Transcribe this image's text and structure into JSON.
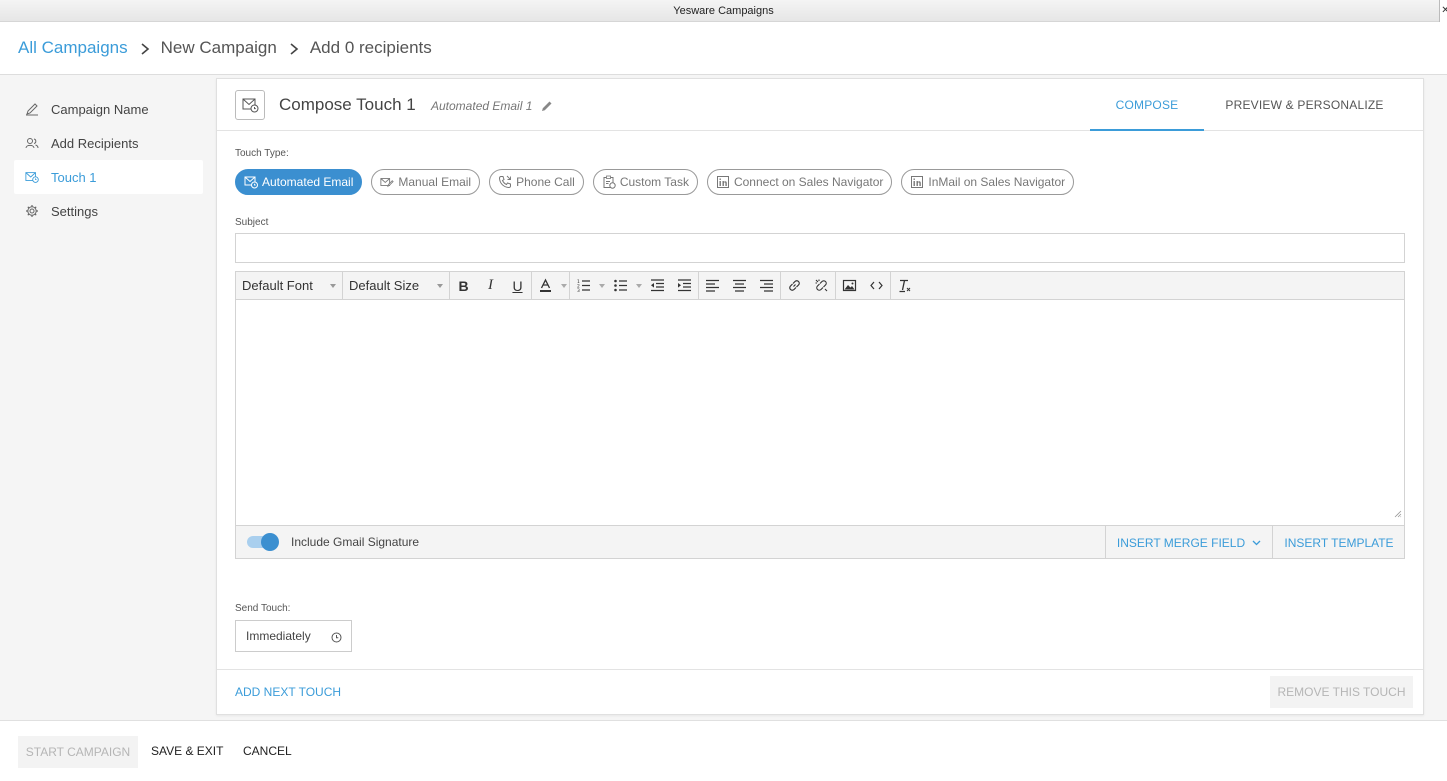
{
  "window": {
    "title": "Yesware Campaigns"
  },
  "breadcrumb": {
    "all_campaigns": "All Campaigns",
    "new_campaign": "New Campaign",
    "add_recipients": "Add 0 recipients"
  },
  "sidebar": {
    "items": [
      {
        "label": "Campaign Name",
        "icon": "pencil-icon"
      },
      {
        "label": "Add Recipients",
        "icon": "users-icon"
      },
      {
        "label": "Touch 1",
        "icon": "email-clock-icon",
        "active": true
      },
      {
        "label": "Settings",
        "icon": "gear-icon"
      }
    ]
  },
  "compose": {
    "title": "Compose Touch 1",
    "subtitle": "Automated Email 1",
    "tabs": {
      "compose": "COMPOSE",
      "preview": "PREVIEW & PERSONALIZE"
    },
    "touch_type_label": "Touch Type:",
    "touch_types": [
      {
        "label": "Automated Email",
        "active": true
      },
      {
        "label": "Manual Email"
      },
      {
        "label": "Phone Call"
      },
      {
        "label": "Custom Task"
      },
      {
        "label": "Connect on Sales Navigator"
      },
      {
        "label": "InMail on Sales Navigator"
      }
    ],
    "subject_label": "Subject",
    "subject_value": "",
    "editor": {
      "font": "Default Font",
      "size": "Default Size",
      "body": ""
    },
    "signature_label": "Include Gmail Signature",
    "signature_enabled": true,
    "insert_merge_field": "INSERT MERGE FIELD",
    "insert_template": "INSERT TEMPLATE",
    "send_touch_label": "Send Touch:",
    "send_touch_value": "Immediately",
    "add_next_touch": "ADD NEXT TOUCH",
    "remove_touch": "REMOVE THIS TOUCH"
  },
  "footer": {
    "start": "START CAMPAIGN",
    "save_exit": "SAVE & EXIT",
    "cancel": "CANCEL"
  },
  "colors": {
    "accent": "#3b9cd9",
    "active_pill": "#3b8fd0"
  }
}
